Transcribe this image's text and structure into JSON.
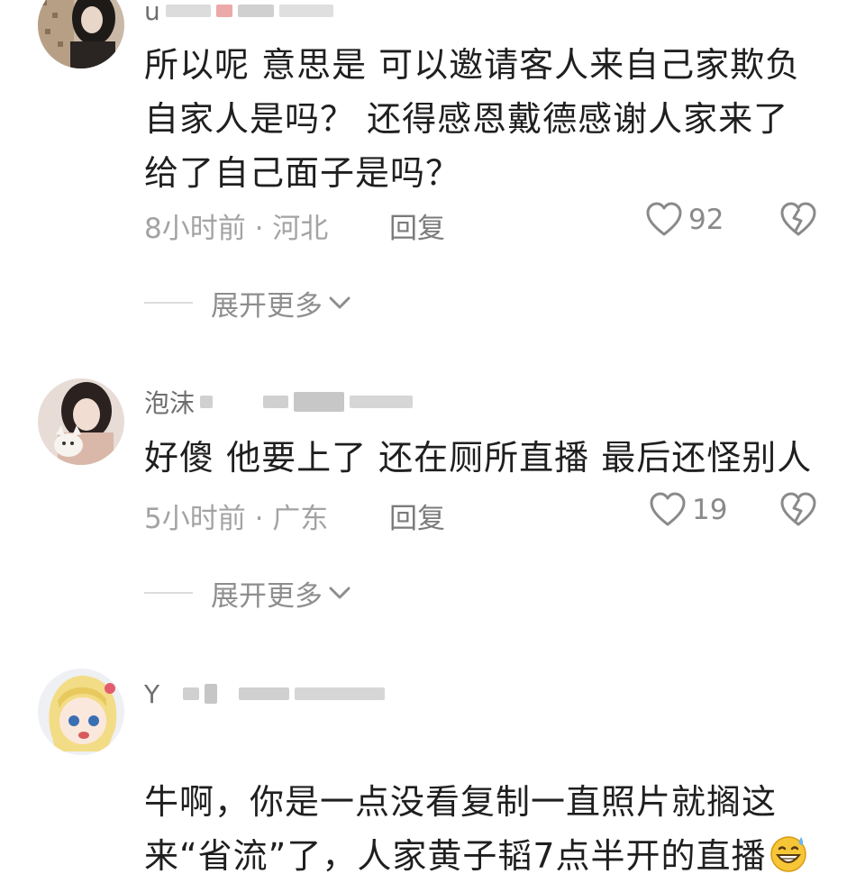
{
  "comments": [
    {
      "username": "u",
      "text": "所以呢  意思是 可以邀请客人来自己家欺负\n自家人是吗？ 还得感恩戴德感谢人家来了\n给了自己面子是吗？",
      "time_location": "8小时前 · 河北",
      "reply": "回复",
      "likes": "92",
      "expand": "展开更多"
    },
    {
      "username": "泡沫",
      "text": "好傻 他要上了 还在厕所直播 最后还怪别人",
      "time_location": "5小时前 · 广东",
      "reply": "回复",
      "likes": "19",
      "expand": "展开更多"
    },
    {
      "username": "Y",
      "text": "牛啊，你是一点没看复制一直照片就搁这\n来“省流”了，人家黄子韬7点半开的直播",
      "emoji": "grinning-sweat-emoji"
    }
  ]
}
